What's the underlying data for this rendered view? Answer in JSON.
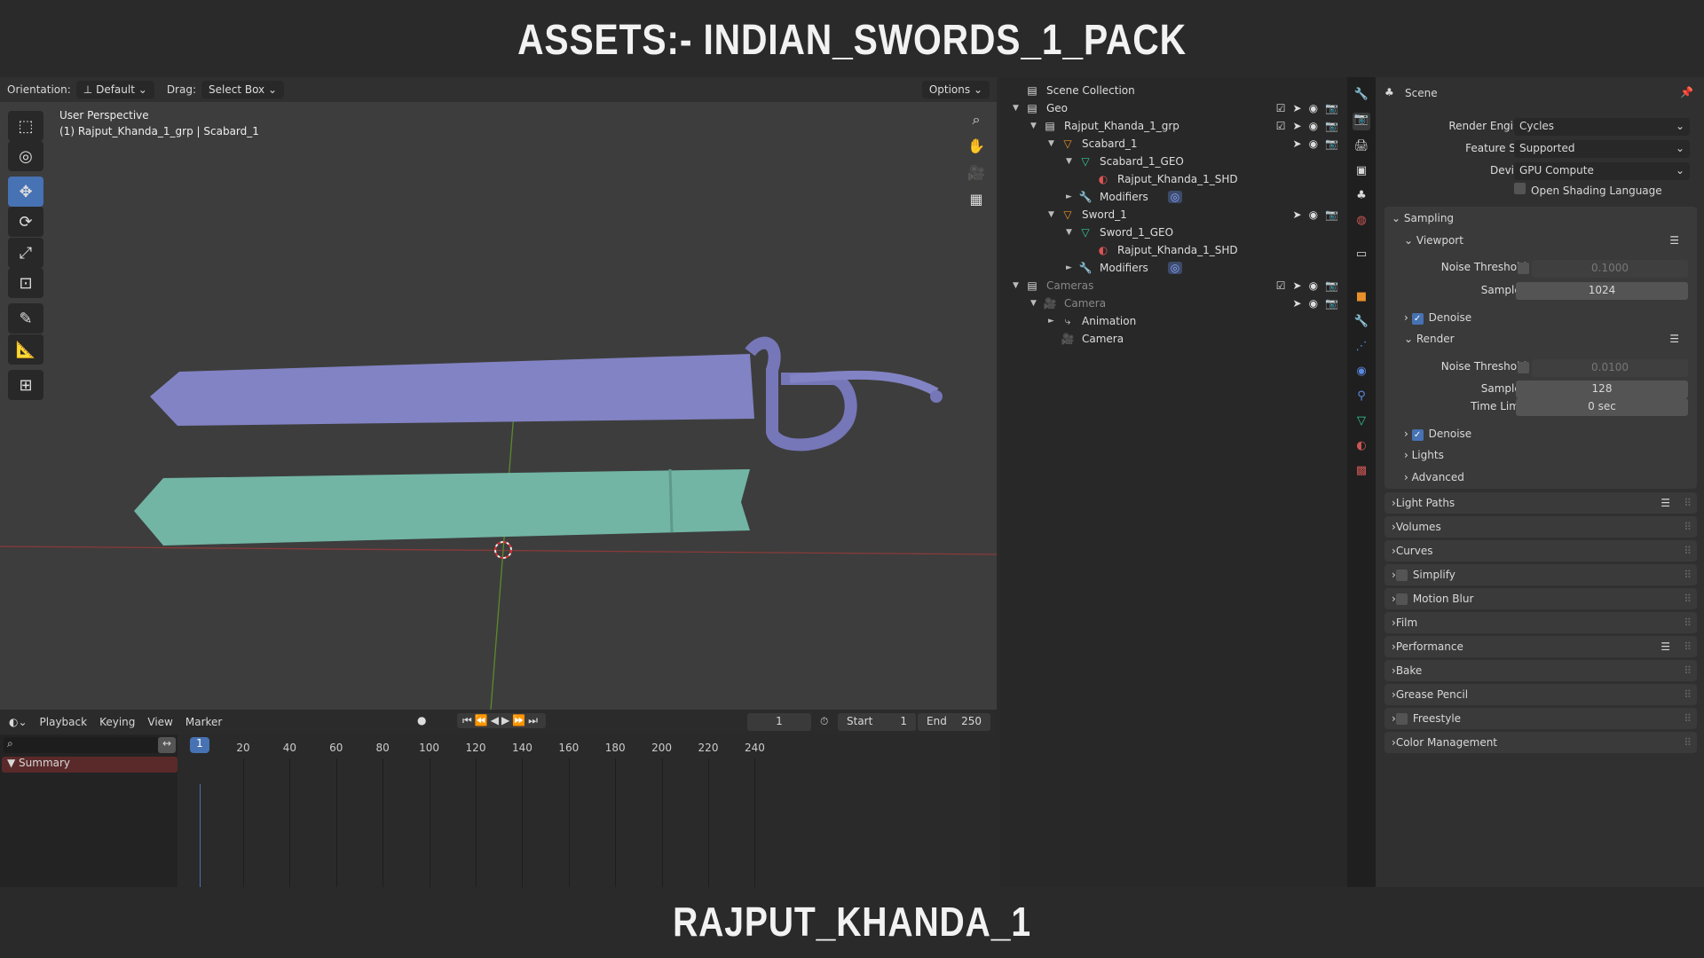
{
  "title": "ASSETS:- INDIAN_SWORDS_1_PACK",
  "subtitle": "RAJPUT_KHANDA_1",
  "viewport": {
    "orientation_label": "Orientation:",
    "orientation_value": "Default",
    "drag_label": "Drag:",
    "drag_value": "Select Box",
    "options": "Options",
    "view_name": "User Perspective",
    "context": "(1) Rajput_Khanda_1_grp | Scabard_1",
    "colors": {
      "sword": "#8283c4",
      "scabbard": "#72b5a4"
    }
  },
  "outliner": {
    "rows": [
      {
        "label": "Scene Collection",
        "depth": 0,
        "icon": "collection-icon",
        "tri": ""
      },
      {
        "label": "Geo",
        "depth": 0,
        "icon": "collection-icon",
        "tri": "▼",
        "vis": "cbse"
      },
      {
        "label": "Rajput_Khanda_1_grp",
        "depth": 1,
        "icon": "collection-icon",
        "tri": "▼",
        "vis": "cbse"
      },
      {
        "label": "Scabard_1",
        "depth": 2,
        "icon": "object-icon",
        "tri": "▼",
        "vis": "se"
      },
      {
        "label": "Scabard_1_GEO",
        "depth": 3,
        "icon": "mesh-icon",
        "tri": "▼"
      },
      {
        "label": "Rajput_Khanda_1_SHD",
        "depth": 4,
        "icon": "material-icon",
        "tri": ""
      },
      {
        "label": "Modifiers",
        "depth": 3,
        "icon": "wrench-icon",
        "tri": "►"
      },
      {
        "label": "Sword_1",
        "depth": 2,
        "icon": "object-icon",
        "tri": "▼",
        "vis": "se"
      },
      {
        "label": "Sword_1_GEO",
        "depth": 3,
        "icon": "mesh-icon",
        "tri": "▼"
      },
      {
        "label": "Rajput_Khanda_1_SHD",
        "depth": 4,
        "icon": "material-icon",
        "tri": ""
      },
      {
        "label": "Modifiers",
        "depth": 3,
        "icon": "wrench-icon",
        "tri": "►"
      },
      {
        "label": "Cameras",
        "depth": 0,
        "icon": "collection-icon",
        "tri": "▼",
        "vis": "cbse",
        "dim": true
      },
      {
        "label": "Camera",
        "depth": 1,
        "icon": "camera-object-icon",
        "tri": "▼",
        "vis": "se",
        "dim": true
      },
      {
        "label": "Animation",
        "depth": 2,
        "icon": "animation-icon",
        "tri": "►"
      },
      {
        "label": "Camera",
        "depth": 2,
        "icon": "camera-data-icon",
        "tri": ""
      }
    ]
  },
  "properties": {
    "header": "Scene",
    "render_engine_label": "Render Engine",
    "render_engine": "Cycles",
    "feature_set_label": "Feature Set",
    "feature_set": "Supported",
    "device_label": "Device",
    "device": "GPU Compute",
    "osl": "Open Shading Language",
    "sampling": "Sampling",
    "viewport": "Viewport",
    "render": "Render",
    "noise_label": "Noise Threshold",
    "samples_label": "Samples",
    "time_limit_label": "Time Limit",
    "vp_noise": "0.1000",
    "vp_samples": "1024",
    "r_noise": "0.0100",
    "r_samples": "128",
    "time_limit": "0 sec",
    "denoise": "Denoise",
    "lights": "Lights",
    "advanced": "Advanced",
    "panels": [
      {
        "label": "Light Paths",
        "list": true
      },
      {
        "label": "Volumes"
      },
      {
        "label": "Curves"
      },
      {
        "label": "Simplify",
        "check": true
      },
      {
        "label": "Motion Blur",
        "check": true
      },
      {
        "label": "Film"
      },
      {
        "label": "Performance",
        "list": true
      },
      {
        "label": "Bake"
      },
      {
        "label": "Grease Pencil"
      },
      {
        "label": "Freestyle",
        "check": true
      },
      {
        "label": "Color Management"
      }
    ]
  },
  "timeline": {
    "menus": [
      "Playback",
      "Keying",
      "View",
      "Marker"
    ],
    "current_frame": "1",
    "start_label": "Start",
    "start": "1",
    "end_label": "End",
    "end": "250",
    "summary": "Summary",
    "ticks": [
      "20",
      "40",
      "60",
      "80",
      "100",
      "120",
      "140",
      "160",
      "180",
      "200",
      "220",
      "240"
    ],
    "playhead": "1"
  }
}
